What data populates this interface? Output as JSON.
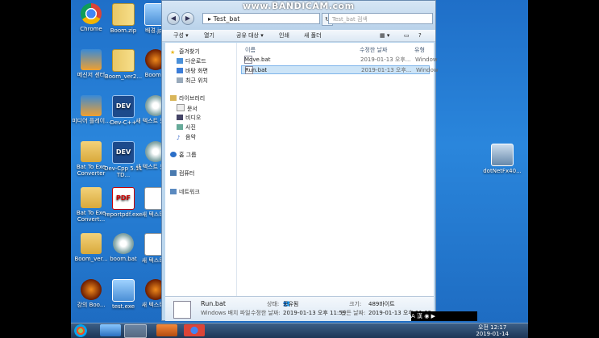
{
  "watermark": "www.BANDICAM.com",
  "desktop_icons": {
    "left": [
      {
        "label": "Chrome",
        "kind": "chrome"
      },
      {
        "label": "메신저 센터",
        "kind": "media"
      },
      {
        "label": "미디어 플레이...",
        "kind": "media"
      },
      {
        "label": "Bat To Exe Converter",
        "kind": "folder"
      },
      {
        "label": "Bat To Exe Convert...",
        "kind": "folder"
      },
      {
        "label": "Boom_ver...",
        "kind": "folder"
      },
      {
        "label": "강의 Boo...",
        "kind": "exe"
      }
    ],
    "middle": [
      {
        "label": "Boom.zip",
        "kind": "zip"
      },
      {
        "label": "Boom_ver2...",
        "kind": "zip"
      },
      {
        "label": "Dev-C++",
        "kind": "dev"
      },
      {
        "label": "Dev-Cpp 5.11 TD...",
        "kind": "dev"
      },
      {
        "label": "reportpdf.exe",
        "kind": "pdf"
      },
      {
        "label": "boom.bat",
        "kind": "gear"
      },
      {
        "label": "test.exe",
        "kind": "img"
      }
    ],
    "right": [
      {
        "label": "배경.jpg",
        "kind": "img"
      },
      {
        "label": "Boom...",
        "kind": "exe"
      },
      {
        "label": "새 텍스트 문서...",
        "kind": "gear"
      },
      {
        "label": "새 텍스트 문서...",
        "kind": "gear"
      },
      {
        "label": "새 텍스트...",
        "kind": "doc"
      },
      {
        "label": "새 텍스트...",
        "kind": "doc"
      },
      {
        "label": "새 텍스트...",
        "kind": "exe"
      }
    ],
    "far_right": {
      "label": "dotNetFx40...",
      "kind": "net"
    }
  },
  "explorer": {
    "address": "Test_bat",
    "search_placeholder": "Test_bat 검색",
    "toolbar": [
      "구성 ▾",
      "열기",
      "공유 대상 ▾",
      "인쇄",
      "새 폴더"
    ],
    "nav": {
      "favorites": "즐겨찾기",
      "favorites_items": [
        "다운로드",
        "바탕 화면",
        "최근 위치"
      ],
      "libraries": "라이브러리",
      "libraries_items": [
        "문서",
        "비디오",
        "사진",
        "음악"
      ],
      "homegroup": "홈 그룹",
      "computer": "컴퓨터",
      "network": "네트워크"
    },
    "columns": {
      "name": "이름",
      "modified": "수정한 날짜",
      "type": "유형"
    },
    "files": [
      {
        "name": "Move.bat",
        "modified": "2019-01-13 오후...",
        "type": "Window",
        "selected": false
      },
      {
        "name": "Run.bat",
        "modified": "2019-01-13 오후...",
        "type": "Window",
        "selected": true
      }
    ],
    "details": {
      "filename": "Run.bat",
      "filetype": "Windows 배치 파일",
      "state_label": "상태:",
      "state_value": "공유됨",
      "modified_label": "수정한 날짜:",
      "modified_value": "2019-01-13 오후 11:59",
      "size_label": "크기:",
      "size_value": "489바이트",
      "created_label": "만든 날짜:",
      "created_value": "2019-01-13 오후 11:02"
    }
  },
  "taskbar": {
    "time": "오전 12:17",
    "date": "2019-01-14",
    "tray_text": "A 漢 ◉ ▶"
  }
}
